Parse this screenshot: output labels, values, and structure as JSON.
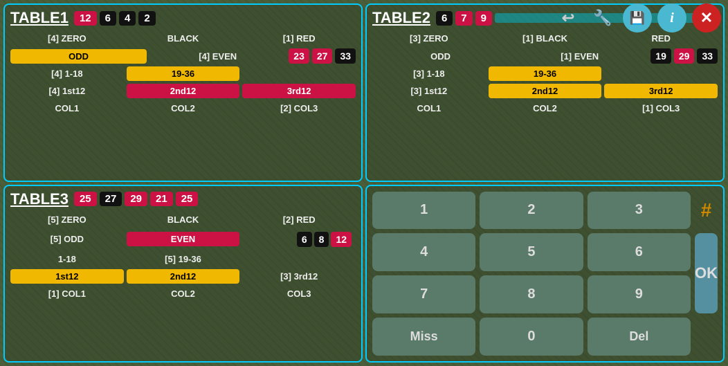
{
  "toolbar": {
    "back_label": "↩",
    "wrench_label": "🔧",
    "save_label": "💾",
    "info_label": "i",
    "close_label": "✕"
  },
  "table1": {
    "title": "TABLE1",
    "badges": [
      {
        "value": "12",
        "type": "crimson"
      },
      {
        "value": "6",
        "type": "black"
      },
      {
        "value": "4",
        "type": "black"
      },
      {
        "value": "2",
        "type": "black"
      }
    ],
    "rows": [
      [
        {
          "text": "[4] ZERO",
          "style": "transparent"
        },
        {
          "text": "BLACK",
          "style": "transparent"
        },
        {
          "text": "[1] RED",
          "style": "transparent"
        }
      ],
      [
        {
          "text": "ODD",
          "style": "yellow"
        },
        {
          "text": "[4] EVEN",
          "style": "transparent"
        },
        {
          "text": "23",
          "style": "crimson"
        },
        {
          "text": "27",
          "style": "crimson"
        },
        {
          "text": "33",
          "style": "black"
        }
      ],
      [
        {
          "text": "[4] 1-18",
          "style": "transparent"
        },
        {
          "text": "19-36",
          "style": "yellow"
        },
        {
          "text": "",
          "style": "transparent"
        }
      ],
      [
        {
          "text": "[4] 1st12",
          "style": "transparent"
        },
        {
          "text": "2nd12",
          "style": "crimson"
        },
        {
          "text": "3rd12",
          "style": "crimson"
        }
      ],
      [
        {
          "text": "COL1",
          "style": "transparent"
        },
        {
          "text": "COL2",
          "style": "transparent"
        },
        {
          "text": "[2] COL3",
          "style": "transparent"
        }
      ]
    ]
  },
  "table2": {
    "title": "TABLE2",
    "badges": [
      {
        "value": "6",
        "type": "black"
      },
      {
        "value": "7",
        "type": "crimson"
      },
      {
        "value": "9",
        "type": "crimson"
      }
    ],
    "rows": [
      [
        {
          "text": "[3] ZERO",
          "style": "transparent"
        },
        {
          "text": "[1] BLACK",
          "style": "transparent"
        },
        {
          "text": "RED",
          "style": "transparent"
        }
      ],
      [
        {
          "text": "ODD",
          "style": "transparent"
        },
        {
          "text": "[1] EVEN",
          "style": "transparent"
        },
        {
          "text": "19",
          "style": "black"
        },
        {
          "text": "29",
          "style": "crimson"
        },
        {
          "text": "33",
          "style": "black"
        }
      ],
      [
        {
          "text": "[3] 1-18",
          "style": "transparent"
        },
        {
          "text": "19-36",
          "style": "yellow"
        },
        {
          "text": "",
          "style": "transparent"
        }
      ],
      [
        {
          "text": "[3] 1st12",
          "style": "transparent"
        },
        {
          "text": "2nd12",
          "style": "yellow"
        },
        {
          "text": "3rd12",
          "style": "yellow"
        }
      ],
      [
        {
          "text": "COL1",
          "style": "transparent"
        },
        {
          "text": "COL2",
          "style": "transparent"
        },
        {
          "text": "[1] COL3",
          "style": "transparent"
        }
      ]
    ]
  },
  "table3": {
    "title": "TABLE3",
    "badges": [
      {
        "value": "25",
        "type": "crimson"
      },
      {
        "value": "27",
        "type": "black"
      },
      {
        "value": "29",
        "type": "crimson"
      },
      {
        "value": "21",
        "type": "crimson"
      },
      {
        "value": "25",
        "type": "crimson"
      }
    ],
    "rows": [
      [
        {
          "text": "[5] ZERO",
          "style": "transparent"
        },
        {
          "text": "BLACK",
          "style": "transparent"
        },
        {
          "text": "[2] RED",
          "style": "transparent"
        }
      ],
      [
        {
          "text": "[5] ODD",
          "style": "transparent"
        },
        {
          "text": "EVEN",
          "style": "crimson"
        },
        {
          "text": "",
          "style": "transparent"
        }
      ],
      [
        {
          "text": "",
          "style": "transparent"
        },
        {
          "text": "",
          "style": "transparent"
        },
        {
          "text": "6",
          "style": "black"
        },
        {
          "text": "8",
          "style": "black"
        },
        {
          "text": "12",
          "style": "crimson"
        }
      ],
      [
        {
          "text": "1-18",
          "style": "transparent"
        },
        {
          "text": "[5] 19-36",
          "style": "transparent"
        },
        {
          "text": "",
          "style": "transparent"
        }
      ],
      [
        {
          "text": "1st12",
          "style": "yellow"
        },
        {
          "text": "2nd12",
          "style": "yellow"
        },
        {
          "text": "[3] 3rd12",
          "style": "transparent"
        }
      ],
      [
        {
          "text": "[1] COL1",
          "style": "transparent"
        },
        {
          "text": "COL2",
          "style": "transparent"
        },
        {
          "text": "COL3",
          "style": "transparent"
        }
      ]
    ]
  },
  "numpad": {
    "buttons": [
      "1",
      "2",
      "3",
      "4",
      "5",
      "6",
      "7",
      "8",
      "9",
      "Miss",
      "0",
      "Del"
    ],
    "ok_label": "OK",
    "hash_label": "#"
  }
}
